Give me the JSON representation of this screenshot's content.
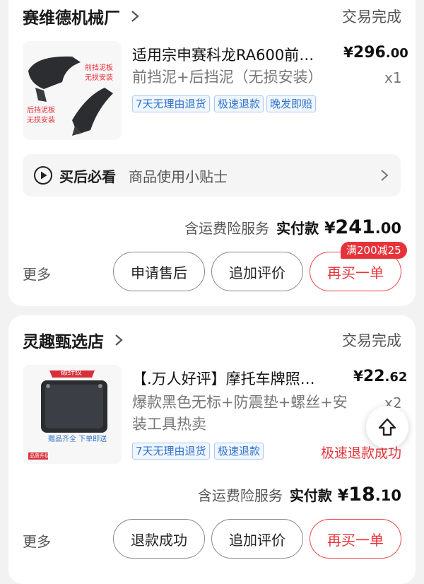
{
  "orders": [
    {
      "shop_name": "赛维德机械厂",
      "status": "交易完成",
      "product_title": "适用宗申赛科龙RA600前…",
      "price_int": "296",
      "price_dec": ".00",
      "spec": "前挡泥+后挡泥（无损安装）",
      "qty": "x1",
      "thumb_text_top": "前挡泥板",
      "thumb_text_top2": "无损安装",
      "thumb_text_bottom": "后挡泥板",
      "thumb_text_bottom2": "无损安装",
      "tags": [
        "7天无理由退货",
        "极速退款",
        "晚发即赔"
      ],
      "tips_title": "买后必看",
      "tips_sub": "商品使用小贴士",
      "insurance": "含运费险服务",
      "paid_label": "实付款",
      "paid_int": "241",
      "paid_dec": ".00",
      "more": "更多",
      "buttons": [
        "申请售后",
        "追加评价",
        "再买一单"
      ],
      "promo": "满200减25"
    },
    {
      "shop_name": "灵趣甄选店",
      "status": "交易完成",
      "product_title": "【.万人好评】摩托车牌照…",
      "price_int": "22",
      "price_dec": ".62",
      "spec_line1": "爆款黑色无标+防震垫+螺丝+安",
      "spec_line2": "装工具热卖",
      "qty": "x2",
      "thumb_badge": "碳纤纹",
      "thumb_caption": "赠品齐全 下单即送",
      "thumb_badge2": "品质升级",
      "tags": [
        "7天无理由退货",
        "极速退款"
      ],
      "refund_status": "极速退款成功",
      "insurance": "含运费险服务",
      "paid_label": "实付款",
      "paid_int": "18",
      "paid_dec": ".10",
      "more": "更多",
      "buttons": [
        "退款成功",
        "追加评价",
        "再买一单"
      ]
    }
  ],
  "currency_symbol": "¥",
  "colors": {
    "accent_red": "#e6333a",
    "tag_blue": "#2f73c9"
  }
}
